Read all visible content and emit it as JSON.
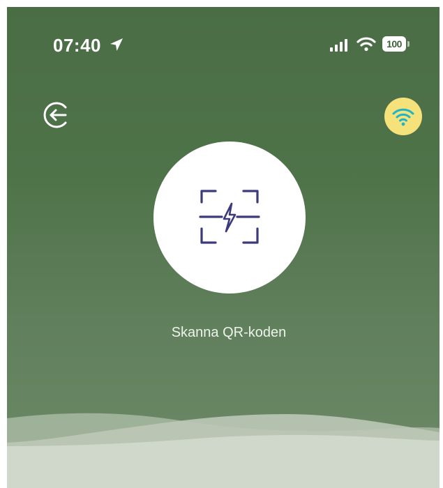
{
  "status_bar": {
    "time": "07:40",
    "location_icon": "location-arrow-icon",
    "signal_icon": "cellular-signal-icon",
    "wifi_icon": "wifi-icon",
    "battery_level": "100"
  },
  "header": {
    "logout_icon": "logout-arrow-icon",
    "wifi_connect_icon": "wifi-icon"
  },
  "main": {
    "scan_icon": "qr-scan-charge-icon",
    "scan_label": "Skanna QR-koden"
  },
  "colors": {
    "background_top": "#4a6d46",
    "background_bottom": "#6f8a68",
    "wifi_badge": "#f6e27a",
    "wifi_glyph": "#21b4c8",
    "scan_icon": "#3b3a7a",
    "wave_light": "#cfd8cb"
  }
}
